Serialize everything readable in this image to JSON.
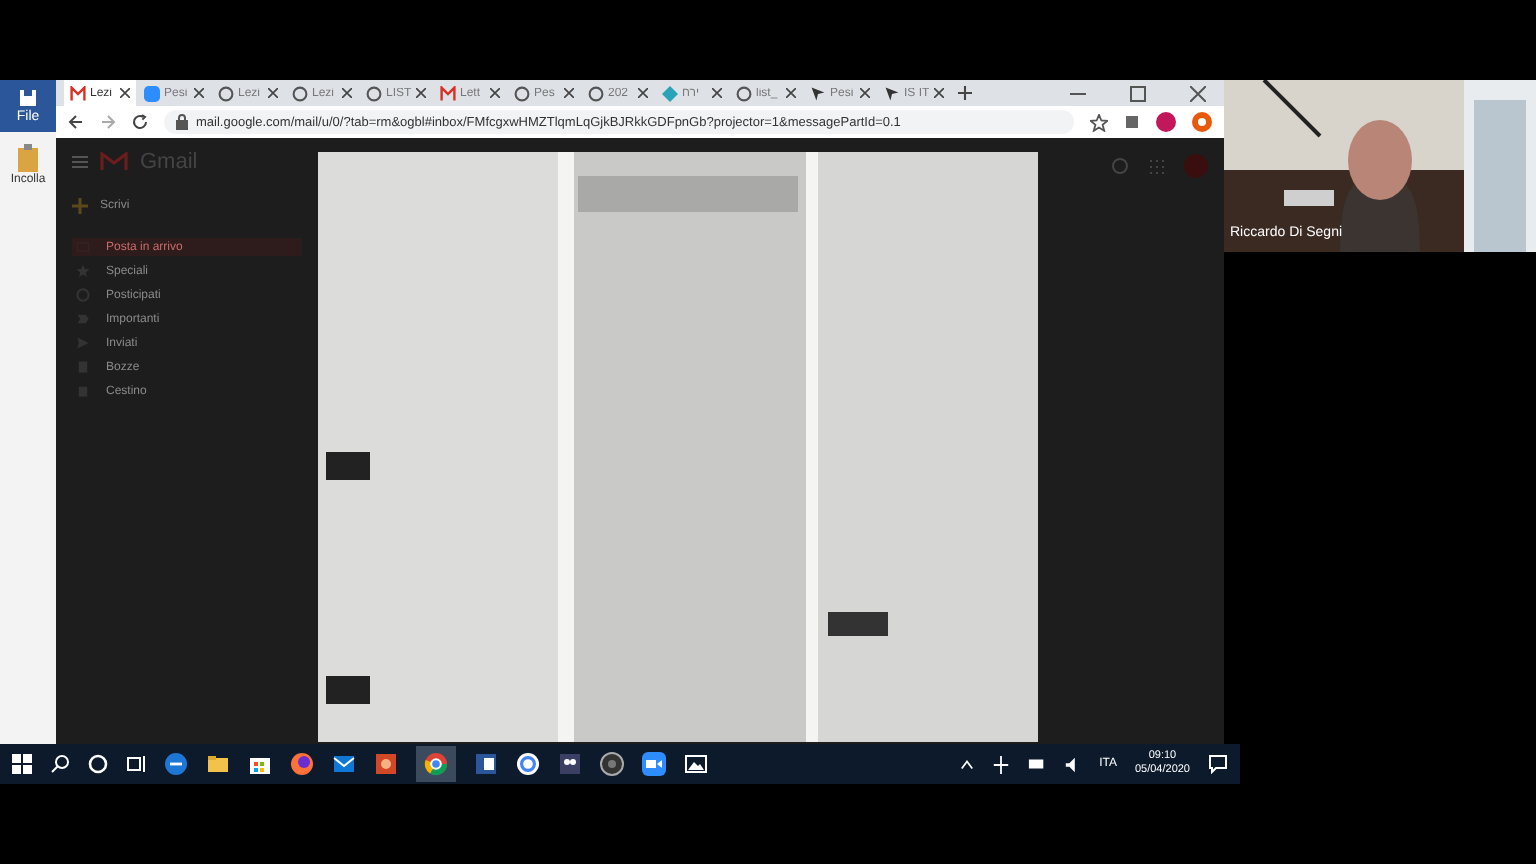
{
  "word": {
    "menu": "File",
    "paste": "Incolla"
  },
  "browser": {
    "tabs": [
      {
        "kind": "gmail",
        "label": "Lezi",
        "selected": true
      },
      {
        "kind": "zoom",
        "label": "Pesi",
        "selected": false
      },
      {
        "kind": "globe",
        "label": "Lezi",
        "selected": false
      },
      {
        "kind": "globe",
        "label": "Lezi",
        "selected": false
      },
      {
        "kind": "globe",
        "label": "LIST",
        "selected": false
      },
      {
        "kind": "gmail",
        "label": "Lett",
        "selected": false
      },
      {
        "kind": "globe",
        "label": "Pes",
        "selected": false
      },
      {
        "kind": "globe",
        "label": "202",
        "selected": false
      },
      {
        "kind": "site",
        "label": "ירח",
        "selected": false
      },
      {
        "kind": "globe",
        "label": "list_",
        "selected": false
      },
      {
        "kind": "pointer",
        "label": "Pesi",
        "selected": false
      },
      {
        "kind": "pointer",
        "label": "IS IT",
        "selected": false
      }
    ],
    "url": "mail.google.com/mail/u/0/?tab=rm&ogbl#inbox/FMfcgxwHMZTlqmLqGjkBJRkkGDFpnGb?projector=1&messagePartId=0.1"
  },
  "gmail": {
    "logo": "Gmail",
    "compose": "Scrivi",
    "folders": [
      {
        "label": "Posta in arrivo",
        "selected": true
      },
      {
        "label": "Speciali",
        "selected": false
      },
      {
        "label": "Posticipati",
        "selected": false
      },
      {
        "label": "Importanti",
        "selected": false
      },
      {
        "label": "Inviati",
        "selected": false
      },
      {
        "label": "Bozze",
        "selected": false
      },
      {
        "label": "Cestino",
        "selected": false
      }
    ]
  },
  "video": {
    "name": "Riccardo Di Segni"
  },
  "taskbar": {
    "language": "ITA",
    "time": "09:10",
    "date": "05/04/2020"
  }
}
